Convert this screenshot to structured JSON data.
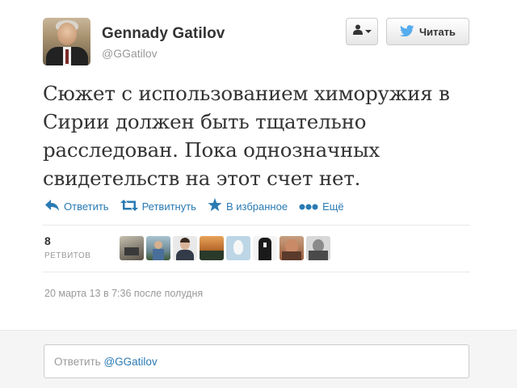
{
  "profile": {
    "name": "Gennady Gatilov",
    "handle": "@GGatilov"
  },
  "buttons": {
    "follow_label": "Читать"
  },
  "tweet": {
    "lines": [
      "Сюжет с использованием химоружия в",
      "Сирии должен быть тщательно",
      "расследован. Пока однозначных",
      "свидетельств на этот счет нет."
    ]
  },
  "actions": {
    "reply": "Ответить",
    "retweet": "Ретвитнуть",
    "favorite": "В избранное",
    "more": "Ещё"
  },
  "stats": {
    "retweets_count": "8",
    "retweets_label": "РЕТВИТОВ"
  },
  "retweeters": [
    {
      "icon": "retweeter-avatar-1",
      "color": "#8a8578"
    },
    {
      "icon": "retweeter-avatar-2",
      "color": "#6e8a96"
    },
    {
      "icon": "retweeter-avatar-3",
      "color": "#556070"
    },
    {
      "icon": "retweeter-avatar-4",
      "color": "#b86a2c"
    },
    {
      "icon": "retweeter-avatar-5",
      "color": "#bdd6e6"
    },
    {
      "icon": "retweeter-avatar-6",
      "color": "#2a2a2a"
    },
    {
      "icon": "retweeter-avatar-7",
      "color": "#9a5a3a"
    },
    {
      "icon": "retweeter-avatar-8",
      "color": "#4a4a4a"
    }
  ],
  "timestamp": "20 марта 13 в 7:36 после полудня",
  "reply": {
    "prefix": "Ответить ",
    "mention": "@GGatilov"
  },
  "colors": {
    "link": "#2a7ab3",
    "twitter_bird": "#55acee",
    "muted": "#999999"
  }
}
